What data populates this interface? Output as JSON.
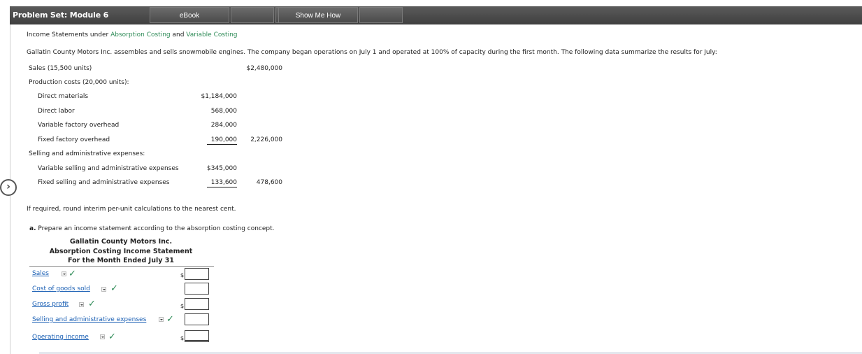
{
  "header": {
    "title": "Problem Set: Module 6",
    "tabs": [
      "eBook",
      "",
      "",
      "Show Me How",
      ""
    ]
  },
  "heading": {
    "prefix": "Income Statements under ",
    "link1": "Absorption Costing",
    "mid": " and ",
    "link2": "Variable Costing"
  },
  "intro": "Gallatin County Motors Inc. assembles and sells snowmobile engines. The company began operations on July 1 and operated at 100% of capacity during the first month. The following data summarize the results for July:",
  "data_table": {
    "sales_label": "Sales (15,500 units)",
    "sales_value": "$2,480,000",
    "prod_label": "Production costs (20,000 units):",
    "dm_label": "Direct materials",
    "dm_value": "$1,184,000",
    "dl_label": "Direct labor",
    "dl_value": "568,000",
    "vfo_label": "Variable factory overhead",
    "vfo_value": "284,000",
    "ffo_label": "Fixed factory overhead",
    "ffo_value": "190,000",
    "prod_total": "2,226,000",
    "sa_label": "Selling and administrative expenses:",
    "vsa_label": "Variable selling and administrative expenses",
    "vsa_value": "$345,000",
    "fsa_label": "Fixed selling and administrative expenses",
    "fsa_value": "133,600",
    "sa_total": "478,600"
  },
  "note": "If required, round interim per-unit calculations to the nearest cent.",
  "part_a": {
    "letter": "a.",
    "text": "Prepare an income statement according to the absorption costing concept."
  },
  "statement": {
    "company": "Gallatin County Motors Inc.",
    "name": "Absorption Costing Income Statement",
    "period": "For the Month Ended July 31",
    "rows": [
      {
        "label": "Sales",
        "dollar": "$",
        "value": ""
      },
      {
        "label": "Cost of goods sold",
        "dollar": "",
        "value": ""
      },
      {
        "label": "Gross profit",
        "dollar": "$",
        "value": ""
      },
      {
        "label": "Selling and administrative expenses",
        "dollar": "",
        "value": ""
      },
      {
        "label": "Operating income",
        "dollar": "$",
        "value": ""
      }
    ]
  },
  "icons": {
    "nav": "chevron-right-icon",
    "check": "checkmark-icon",
    "dropdown": "dropdown-arrow-icon"
  },
  "colors": {
    "link_green": "#2e8b57",
    "select_blue": "#1a5fb4",
    "header_bg": "#4a4a4a"
  }
}
